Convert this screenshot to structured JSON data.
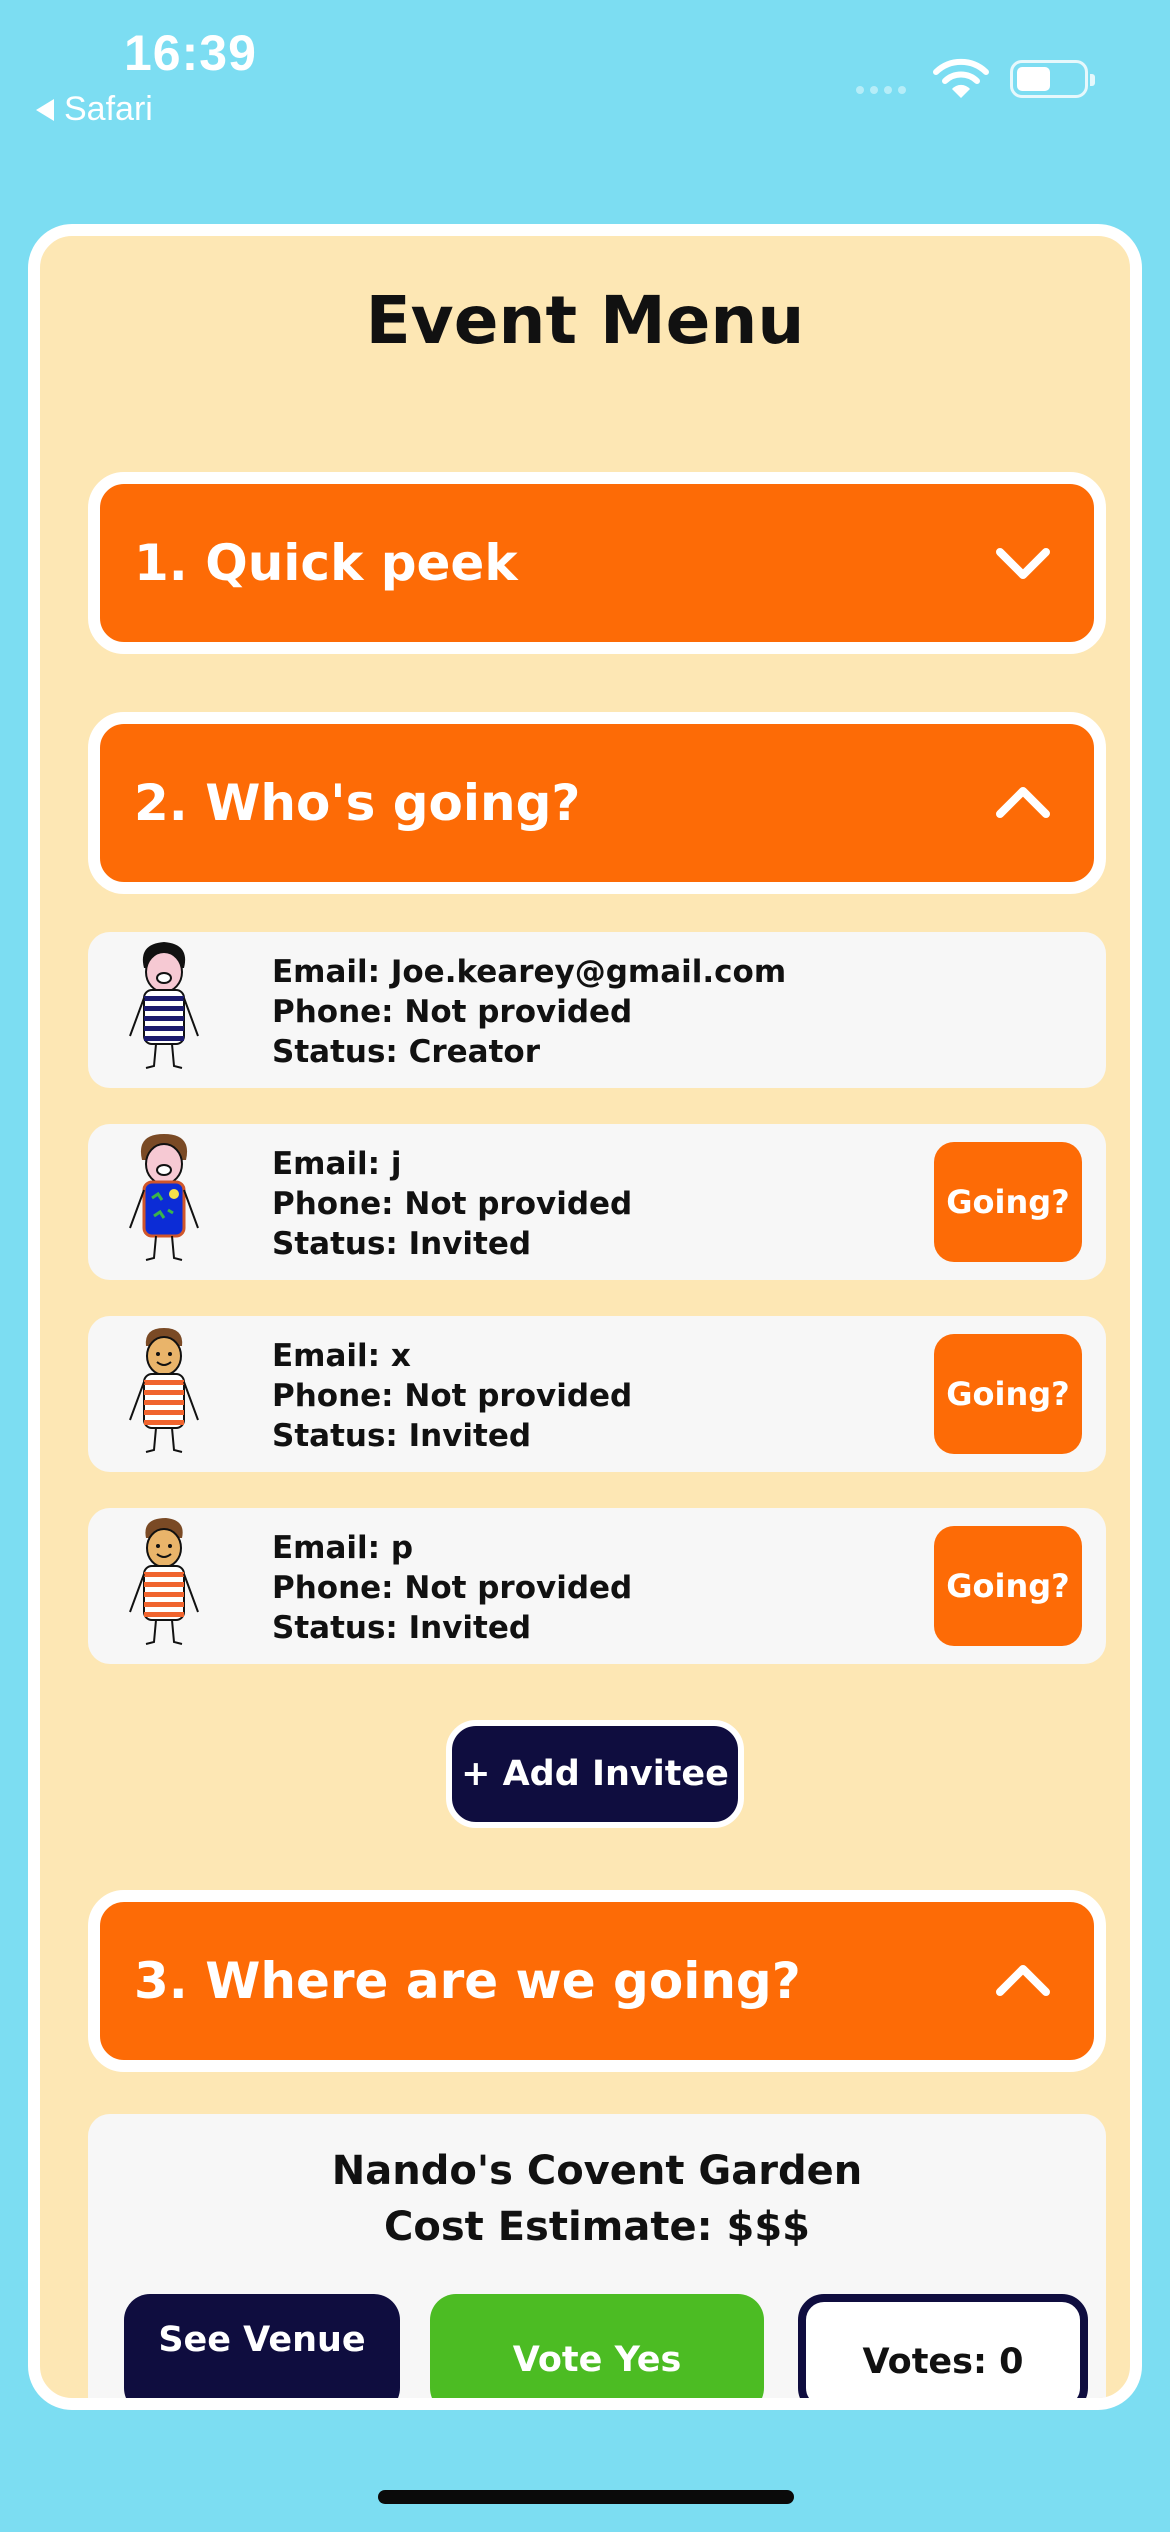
{
  "status_bar": {
    "time": "16:39",
    "back_label": "Safari",
    "battery_level": 0.52
  },
  "page": {
    "title": "Event Menu"
  },
  "sections": [
    {
      "label": "1. Quick peek",
      "expanded": false,
      "icon": "chevron-down-icon"
    },
    {
      "label": "2. Who's going?",
      "expanded": true,
      "icon": "chevron-up-icon"
    },
    {
      "label": "3. Where are we going?",
      "expanded": true,
      "icon": "chevron-up-icon"
    }
  ],
  "invitees": [
    {
      "email": "Email: Joe.kearey@gmail.com",
      "phone": "Phone: Not provided",
      "status": "Status: Creator",
      "shirt": "navy-stripes"
    },
    {
      "email": "Email: j",
      "phone": "Phone: Not provided",
      "status": "Status: Invited",
      "button": "Going?",
      "shirt": "blue-pattern"
    },
    {
      "email": "Email: x",
      "phone": "Phone: Not provided",
      "status": "Status: Invited",
      "button": "Going?",
      "shirt": "orange-stripes"
    },
    {
      "email": "Email: p",
      "phone": "Phone: Not provided",
      "status": "Status: Invited",
      "button": "Going?",
      "shirt": "orange-stripes"
    }
  ],
  "add_invitee_label": "+ Add Invitee",
  "venue": {
    "name": "Nando's Covent Garden",
    "cost": "Cost Estimate: $$$",
    "see_venue_label": "See Venue",
    "vote_yes_label": "Vote Yes",
    "votes_label": "Votes: 0"
  },
  "colors": {
    "background": "#7cddf2",
    "card": "#fde7b4",
    "accent_orange": "#fd6b06",
    "navy": "#0f0d3f",
    "green": "#4cbc23"
  }
}
